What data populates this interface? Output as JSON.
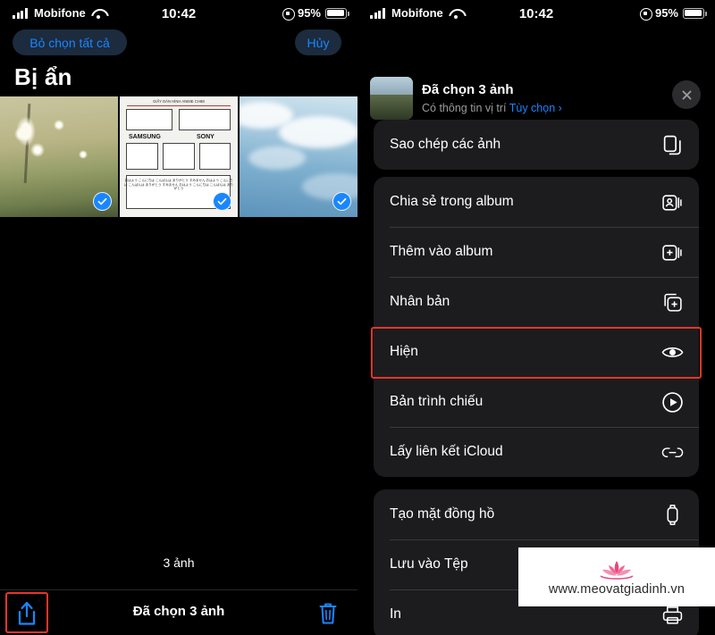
{
  "status_bar": {
    "carrier": "Mobifone",
    "time": "10:42",
    "battery_pct": "95%",
    "signal_icon": "cellular-bars-icon",
    "wifi_icon": "wifi-icon",
    "lock_icon": "rotation-lock-icon",
    "battery_icon": "battery-icon"
  },
  "left": {
    "deselect_all": "Bỏ chọn tất cả",
    "cancel": "Hủy",
    "page_title": "Bị ẩn",
    "count_label": "3 ảnh",
    "bottom_title": "Đã chọn 3 ảnh",
    "share_icon": "share-icon",
    "trash_icon": "trash-icon",
    "thumbnails": [
      {
        "name": "photo-field-flowers",
        "selected": true
      },
      {
        "name": "photo-comic-sheet",
        "selected": true
      },
      {
        "name": "photo-sky-clouds",
        "selected": true
      }
    ]
  },
  "share_sheet": {
    "title": "Đã chọn 3 ảnh",
    "subtitle_text": "Có thông tin vị trí",
    "options_link": "Tùy chọn ›",
    "close_icon": "close-icon",
    "thumbnail_name": "selection-thumbnail",
    "groups": [
      {
        "rows": [
          {
            "label": "Sao chép các ảnh",
            "icon": "copy-icon"
          }
        ]
      },
      {
        "rows": [
          {
            "label": "Chia sẻ trong album",
            "icon": "shared-album-icon"
          },
          {
            "label": "Thêm vào album",
            "icon": "add-to-album-icon"
          },
          {
            "label": "Nhân bản",
            "icon": "duplicate-icon"
          },
          {
            "label": "Hiện",
            "icon": "eye-icon",
            "highlighted": true
          },
          {
            "label": "Bản trình chiếu",
            "icon": "play-circle-icon"
          },
          {
            "label": "Lấy liên kết iCloud",
            "icon": "link-icon"
          }
        ]
      },
      {
        "rows": [
          {
            "label": "Tạo mặt đồng hồ",
            "icon": "watch-icon"
          },
          {
            "label": "Lưu vào Tệp",
            "icon": "folder-icon"
          },
          {
            "label": "In",
            "icon": "printer-icon"
          }
        ]
      }
    ]
  },
  "watermark": {
    "url": "www.meovatgiadinh.vn",
    "logo_icon": "lotus-logo-icon"
  },
  "colors": {
    "accent_blue": "#1a86ff",
    "highlight_red": "#e8352a",
    "sheet_bg": "#1c1c1e",
    "pill_bg": "#1c2b3e"
  }
}
